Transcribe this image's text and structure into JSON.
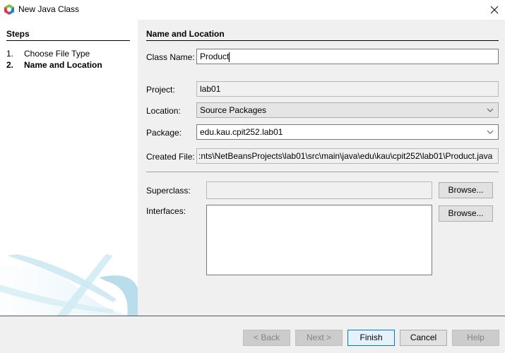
{
  "window": {
    "title": "New Java Class",
    "app_icon": "netbeans-cube-icon",
    "close_icon": "close-icon"
  },
  "steps": {
    "heading": "Steps",
    "items": [
      {
        "num": "1.",
        "label": "Choose File Type",
        "active": false
      },
      {
        "num": "2.",
        "label": "Name and Location",
        "active": true
      }
    ]
  },
  "form": {
    "heading": "Name and Location",
    "class_name": {
      "label": "Class Name:",
      "value": "Product"
    },
    "project": {
      "label": "Project:",
      "value": "lab01"
    },
    "location": {
      "label": "Location:",
      "value": "Source Packages"
    },
    "package": {
      "label": "Package:",
      "value": "edu.kau.cpit252.lab01"
    },
    "created_file": {
      "label": "Created File:",
      "value": ":nts\\NetBeansProjects\\lab01\\src\\main\\java\\edu\\kau\\cpit252\\lab01\\Product.java"
    },
    "superclass": {
      "label": "Superclass:",
      "value": "",
      "browse_label": "Browse..."
    },
    "interfaces": {
      "label": "Interfaces:",
      "value": "",
      "browse_label": "Browse..."
    }
  },
  "buttons": {
    "back": "< Back",
    "next": "Next >",
    "finish": "Finish",
    "cancel": "Cancel",
    "help": "Help"
  },
  "colors": {
    "default_button_border": "#0078d7",
    "default_button_bg": "#e5f1fb",
    "dialog_bg": "#f0f0f0"
  }
}
